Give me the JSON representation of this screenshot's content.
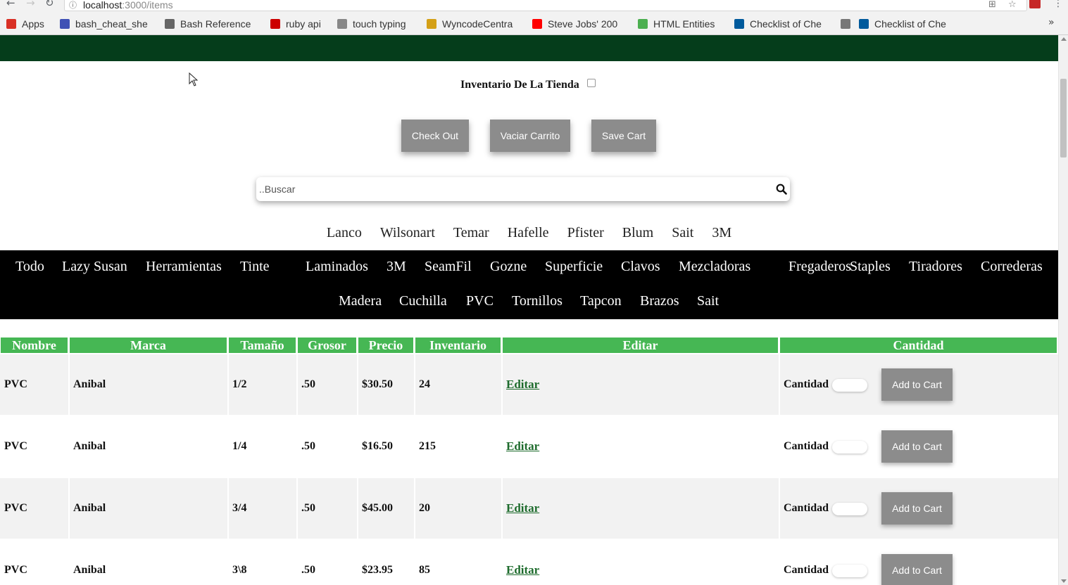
{
  "browser": {
    "url_host": "localhost",
    "url_rest": ":3000/items",
    "bookmarks": [
      {
        "label": "Apps",
        "icon": "apps-grid-icon",
        "color": "#d93025"
      },
      {
        "label": "bash_cheat_she",
        "icon": "bookmark-page-icon",
        "color": "#3f51b5"
      },
      {
        "label": "Bash Reference",
        "icon": "gnu-head-icon",
        "color": "#666666"
      },
      {
        "label": "ruby api",
        "icon": "ruby-icon",
        "color": "#cc0000"
      },
      {
        "label": "touch typing",
        "icon": "keyboard-icon",
        "color": "#888888"
      },
      {
        "label": "WyncodeCentra",
        "icon": "key-icon",
        "color": "#d4a017"
      },
      {
        "label": "Steve Jobs' 200",
        "icon": "youtube-icon",
        "color": "#ff0000"
      },
      {
        "label": "HTML Entities",
        "icon": "code-icon",
        "color": "#4caf50"
      },
      {
        "label": "Checklist of Che",
        "icon": "w3c-icon",
        "color": "#005a9c"
      },
      {
        "label": "",
        "icon": "document-icon",
        "color": "#777777"
      },
      {
        "label": "Checklist of Che",
        "icon": "w3c-icon",
        "color": "#005a9c"
      }
    ]
  },
  "header": {
    "inventory_label": "Inventario De La Tienda",
    "buttons": {
      "checkout": "Check Out",
      "empty_cart": "Vaciar Carrito",
      "save_cart": "Save Cart"
    }
  },
  "search": {
    "placeholder": "..Buscar",
    "value": ""
  },
  "brands": [
    "Lanco",
    "Wilsonart",
    "Temar",
    "Hafelle",
    "Pfister",
    "Blum",
    "Sait",
    "3M"
  ],
  "categories_row1": [
    "Todo",
    "Lazy Susan",
    "Herramientas",
    "Tinte",
    "Laminados",
    "3M",
    "SeamFil",
    "Gozne",
    "Superficie",
    "Clavos",
    "Mezcladoras",
    "Fregaderos",
    "Staples",
    "Tiradores",
    "Correderas"
  ],
  "categories_row2": [
    "Madera",
    "Cuchilla",
    "PVC",
    "Tornillos",
    "Tapcon",
    "Brazos",
    "Sait"
  ],
  "table": {
    "headers": [
      "Nombre",
      "Marca",
      "Tamaño",
      "Grosor",
      "Precio",
      "Inventario",
      "Editar",
      "Cantidad"
    ],
    "quantity_label": "Cantidad",
    "edit_label": "Editar",
    "add_label": "Add to Cart",
    "rows": [
      {
        "nombre": "PVC",
        "marca": "Anibal",
        "tamano": "1/2",
        "grosor": ".50",
        "precio": "$30.50",
        "inventario": "24"
      },
      {
        "nombre": "PVC",
        "marca": "Anibal",
        "tamano": "1/4",
        "grosor": ".50",
        "precio": "$16.50",
        "inventario": "215"
      },
      {
        "nombre": "PVC",
        "marca": "Anibal",
        "tamano": "3/4",
        "grosor": ".50",
        "precio": "$45.00",
        "inventario": "20"
      },
      {
        "nombre": "PVC",
        "marca": "Anibal",
        "tamano": "3\\8",
        "grosor": ".50",
        "precio": "$23.95",
        "inventario": "85"
      }
    ]
  },
  "colors": {
    "top_bar": "#053d1b",
    "table_header": "#46b754",
    "button": "#8c8c8c",
    "row_alt": "#f2f2f2"
  }
}
